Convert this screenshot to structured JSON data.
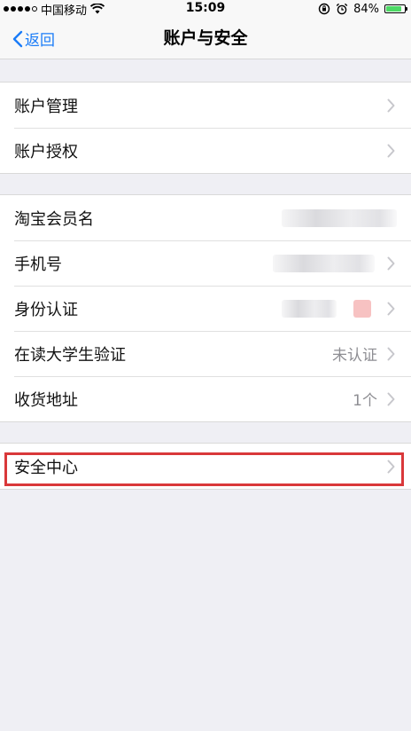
{
  "status_bar": {
    "carrier": "中国移动",
    "time": "15:09",
    "battery": "84%",
    "battery_level": 0.84
  },
  "nav": {
    "back_label": "返回",
    "title": "账户与安全"
  },
  "group1": {
    "rows": [
      {
        "label": "账户管理",
        "value": ""
      },
      {
        "label": "账户授权",
        "value": ""
      }
    ]
  },
  "group2": {
    "rows": [
      {
        "label": "淘宝会员名",
        "value": ""
      },
      {
        "label": "手机号",
        "value": ""
      },
      {
        "label": "身份认证",
        "value": ""
      },
      {
        "label": "在读大学生验证",
        "value": "未认证"
      },
      {
        "label": "收货地址",
        "value": "1个"
      }
    ]
  },
  "group3": {
    "rows": [
      {
        "label": "安全中心",
        "value": ""
      }
    ]
  },
  "colors": {
    "accent": "#1a7cf8",
    "highlight": "#d9383a",
    "background": "#efeff4"
  }
}
